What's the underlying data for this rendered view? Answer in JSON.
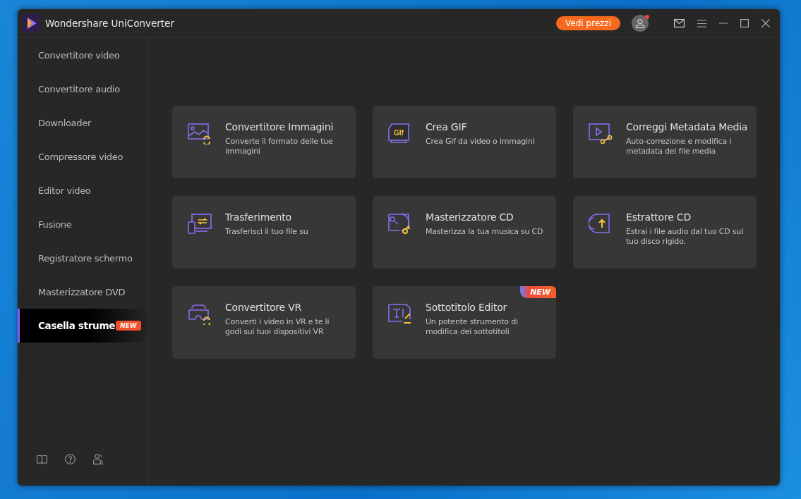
{
  "window": {
    "title": "Wondershare UniConverter"
  },
  "header": {
    "pricing_button": "Vedi prezzi",
    "notification_dot": true
  },
  "sidebar": {
    "items": [
      {
        "label": "Convertitore video",
        "selected": false
      },
      {
        "label": "Convertitore audio",
        "selected": false
      },
      {
        "label": "Downloader",
        "selected": false
      },
      {
        "label": "Compressore video",
        "selected": false
      },
      {
        "label": "Editor video",
        "selected": false
      },
      {
        "label": "Fusione",
        "selected": false
      },
      {
        "label": "Registratore schermo",
        "selected": false
      },
      {
        "label": "Masterizzatore DVD",
        "selected": false
      },
      {
        "label": "Casella strume",
        "selected": true,
        "badge": "NEW"
      }
    ]
  },
  "tools": [
    {
      "title": "Convertitore Immagini",
      "description": "Converte il formato delle tue immagini"
    },
    {
      "title": "Crea GIF",
      "description": "Crea Gif da video o immagini",
      "icon_text": "GIf"
    },
    {
      "title": "Correggi Metadata Media",
      "description": "Auto-correzione e modifica i metadata dei file media"
    },
    {
      "title": "Trasferimento",
      "description": "Trasferisci il tuo file su"
    },
    {
      "title": "Masterizzatore CD",
      "description": "Masterizza la tua musica su CD"
    },
    {
      "title": "Estrattore CD",
      "description": "Estrai i file audio dal tuo CD sul tuo disco rigido."
    },
    {
      "title": "Convertitore VR",
      "description": "Converti i video in VR e te li godi sui tuoi dispositivi VR"
    },
    {
      "title": "Sottotitolo Editor",
      "description": "Un potente strumento di modifica dei sottotitoli",
      "badge": "NEW"
    }
  ]
}
